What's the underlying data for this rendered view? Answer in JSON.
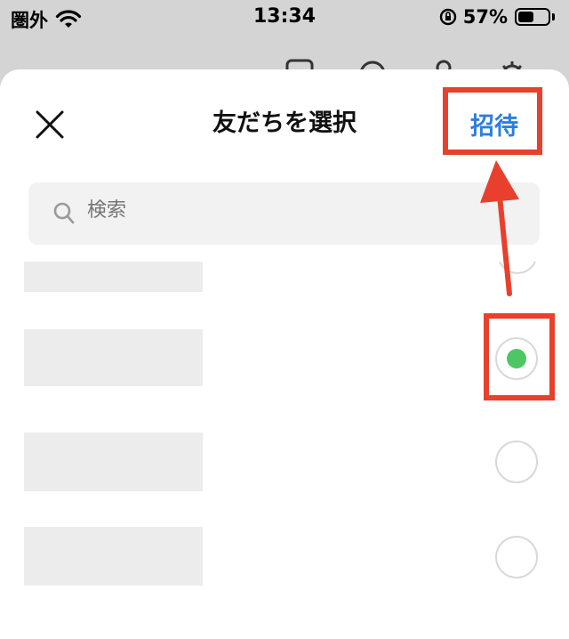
{
  "status_bar": {
    "carrier": "圏外",
    "time": "13:34",
    "battery_percent": "57%",
    "battery_level": 0.57
  },
  "background_toolbar": {
    "icons": [
      "bookmark-icon",
      "search-icon",
      "profile-icon",
      "settings-icon"
    ]
  },
  "sheet": {
    "title": "友だちを選択",
    "invite_label": "招待",
    "invite_color": "#2f7de0",
    "search": {
      "placeholder": "検索"
    },
    "friends": [
      {
        "selected": false
      },
      {
        "selected": true
      },
      {
        "selected": false
      },
      {
        "selected": false
      }
    ]
  },
  "annotations": {
    "highlight_color": "#e8402c",
    "targets": [
      "invite-button",
      "friend-checkbox-selected"
    ]
  },
  "colors": {
    "selected_green": "#4cc763",
    "placeholder_gray": "#ececec"
  }
}
